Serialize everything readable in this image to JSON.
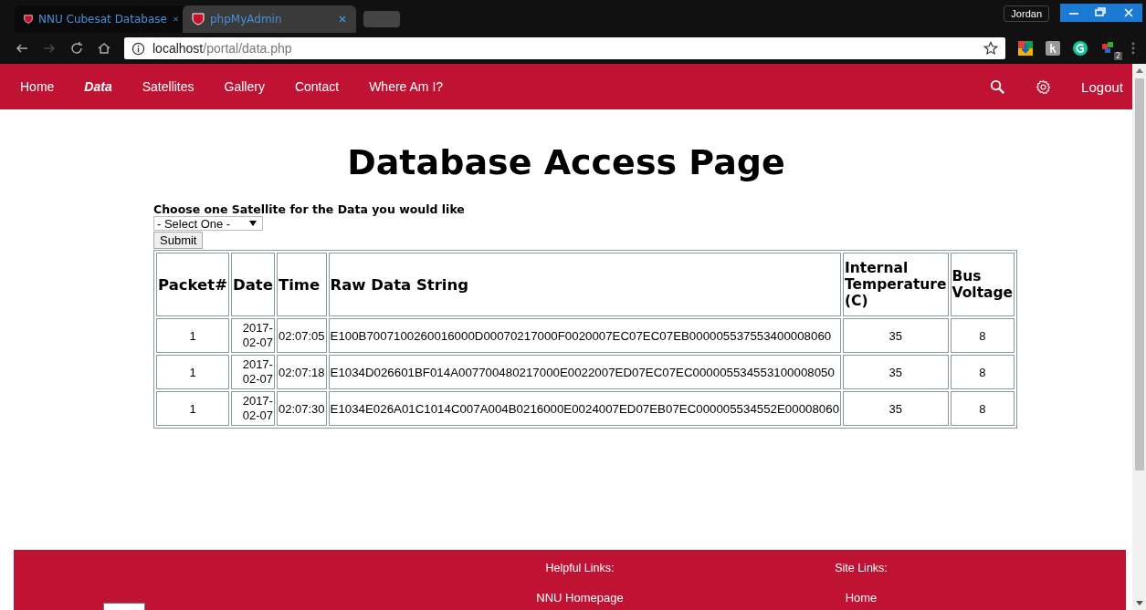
{
  "browser": {
    "tabs": [
      {
        "title": "NNU Cubesat Database",
        "selected": true
      },
      {
        "title": "phpMyAdmin",
        "selected": false
      }
    ],
    "profile": "Jordan",
    "url_host": "localhost",
    "url_path": "/portal/data.php",
    "extension_badge": "2"
  },
  "nav": {
    "items": [
      {
        "label": "Home",
        "selected": false
      },
      {
        "label": "Data",
        "selected": true
      },
      {
        "label": "Satellites",
        "selected": false
      },
      {
        "label": "Gallery",
        "selected": false
      },
      {
        "label": "Contact",
        "selected": false
      },
      {
        "label": "Where Am I?",
        "selected": false
      }
    ],
    "logout": "Logout"
  },
  "heading": "Database Access Page",
  "form": {
    "label": "Choose one Satellite for the Data you would like",
    "select": "- Select One -",
    "submit": "Submit"
  },
  "table": {
    "columns": [
      "Packet#",
      "Date",
      "Time",
      "Raw Data String",
      "Internal Temperature (C)",
      "Bus Voltage"
    ],
    "rows": [
      [
        "1",
        "2017-02-07",
        "02:07:05",
        "E100B7007100260016000D00070217000F0020007EC07EC07EB000005537553400008060",
        "35",
        "8"
      ],
      [
        "1",
        "2017-02-07",
        "02:07:18",
        "E1034D026601BF014A007700480217000E0022007ED07EC07EC000005534553100008050",
        "35",
        "8"
      ],
      [
        "1",
        "2017-02-07",
        "02:07:30",
        "E1034E026A01C1014C007A004B0216000E0024007ED07EB07EC000005534552E00008060",
        "35",
        "8"
      ]
    ]
  },
  "footer": {
    "columns": [
      {
        "heading": "Helpful Links:",
        "links": [
          "NNU Homepage"
        ]
      },
      {
        "heading": "Site Links:",
        "links": [
          "Home"
        ]
      }
    ]
  }
}
